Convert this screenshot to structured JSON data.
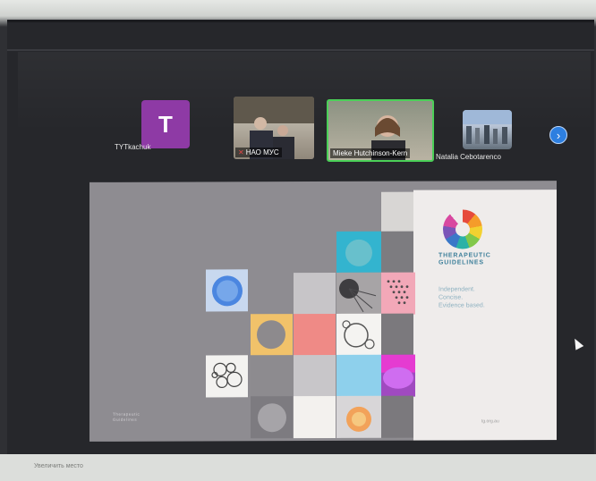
{
  "participants": [
    {
      "initial": "T",
      "name": "TYTkachuk"
    },
    {
      "name": "НАО МУС",
      "mic_muted": true
    },
    {
      "name": "Mieke Hutchinson-Kern",
      "active_speaker": true
    },
    {
      "name": "Natalia Cebotarenco"
    }
  ],
  "strip": {
    "next_icon": "chevron-right-icon",
    "next_glyph": "›"
  },
  "slide": {
    "brand_line1": "THERAPEUTIC",
    "brand_line2": "GUIDELINES",
    "tagline_line1": "Independent.",
    "tagline_line2": "Concise.",
    "tagline_line3": "Evidence based.",
    "footer_left_line1": "Therapeutic",
    "footer_left_line2": "Guidelines",
    "footer_right": "tg.org.au"
  },
  "taskbar": {
    "text": "Увеличить место"
  },
  "colors": {
    "avatar": "#8e3aa5",
    "active_speaker_border": "#4bd058",
    "next_button": "#2d7fe0",
    "brand": "#3d7f9a"
  }
}
